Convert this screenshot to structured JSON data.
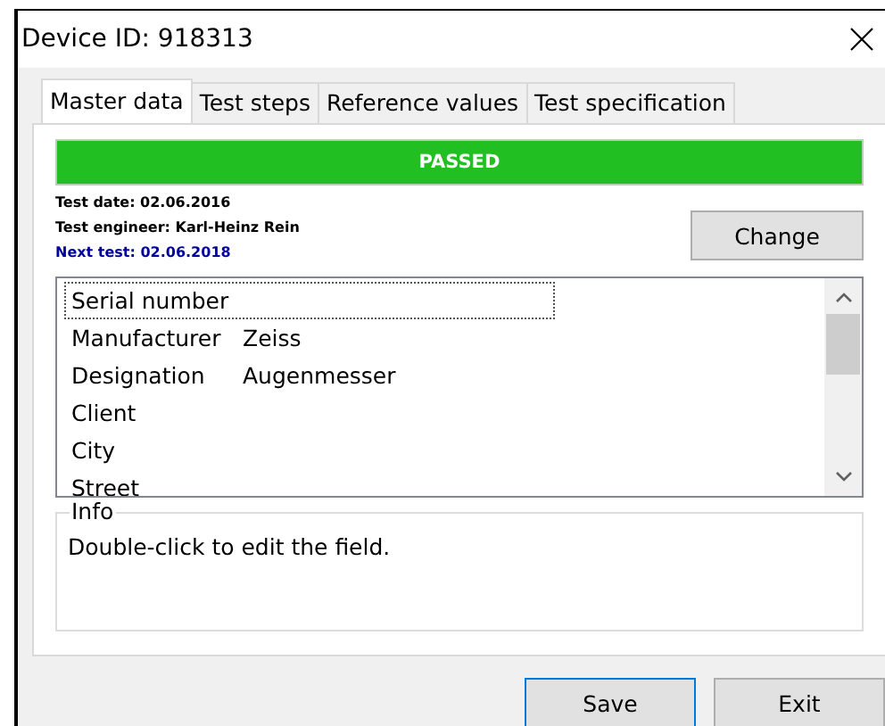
{
  "window": {
    "title": "Device ID: 918313"
  },
  "tabs": [
    {
      "label": "Master data",
      "selected": true
    },
    {
      "label": "Test steps",
      "selected": false
    },
    {
      "label": "Reference values",
      "selected": false
    },
    {
      "label": "Test specification",
      "selected": false
    }
  ],
  "status": {
    "label": "PASSED",
    "kind": "passed"
  },
  "details": [
    {
      "text": "Test date: 02.06.2016",
      "highlight": false
    },
    {
      "text": "Test engineer: Karl-Heinz Rein",
      "highlight": false
    },
    {
      "text": "Next test: 02.06.2018",
      "highlight": true
    }
  ],
  "change_button": "Change",
  "fields": [
    {
      "label": "Serial number",
      "selected": true
    },
    {
      "label": "Manufacturer",
      "value": "Zeiss",
      "selected": false
    },
    {
      "label": "Designation",
      "value": "Augenmesser",
      "selected": false
    },
    {
      "label": "Client",
      "selected": false
    },
    {
      "label": "City",
      "selected": false
    },
    {
      "label": "Street",
      "selected": false
    }
  ],
  "info": {
    "title": "Info",
    "text": "Double-click to edit the field."
  },
  "buttons": [
    {
      "label": "Save",
      "default": true
    },
    {
      "label": "Exit",
      "default": false
    }
  ]
}
